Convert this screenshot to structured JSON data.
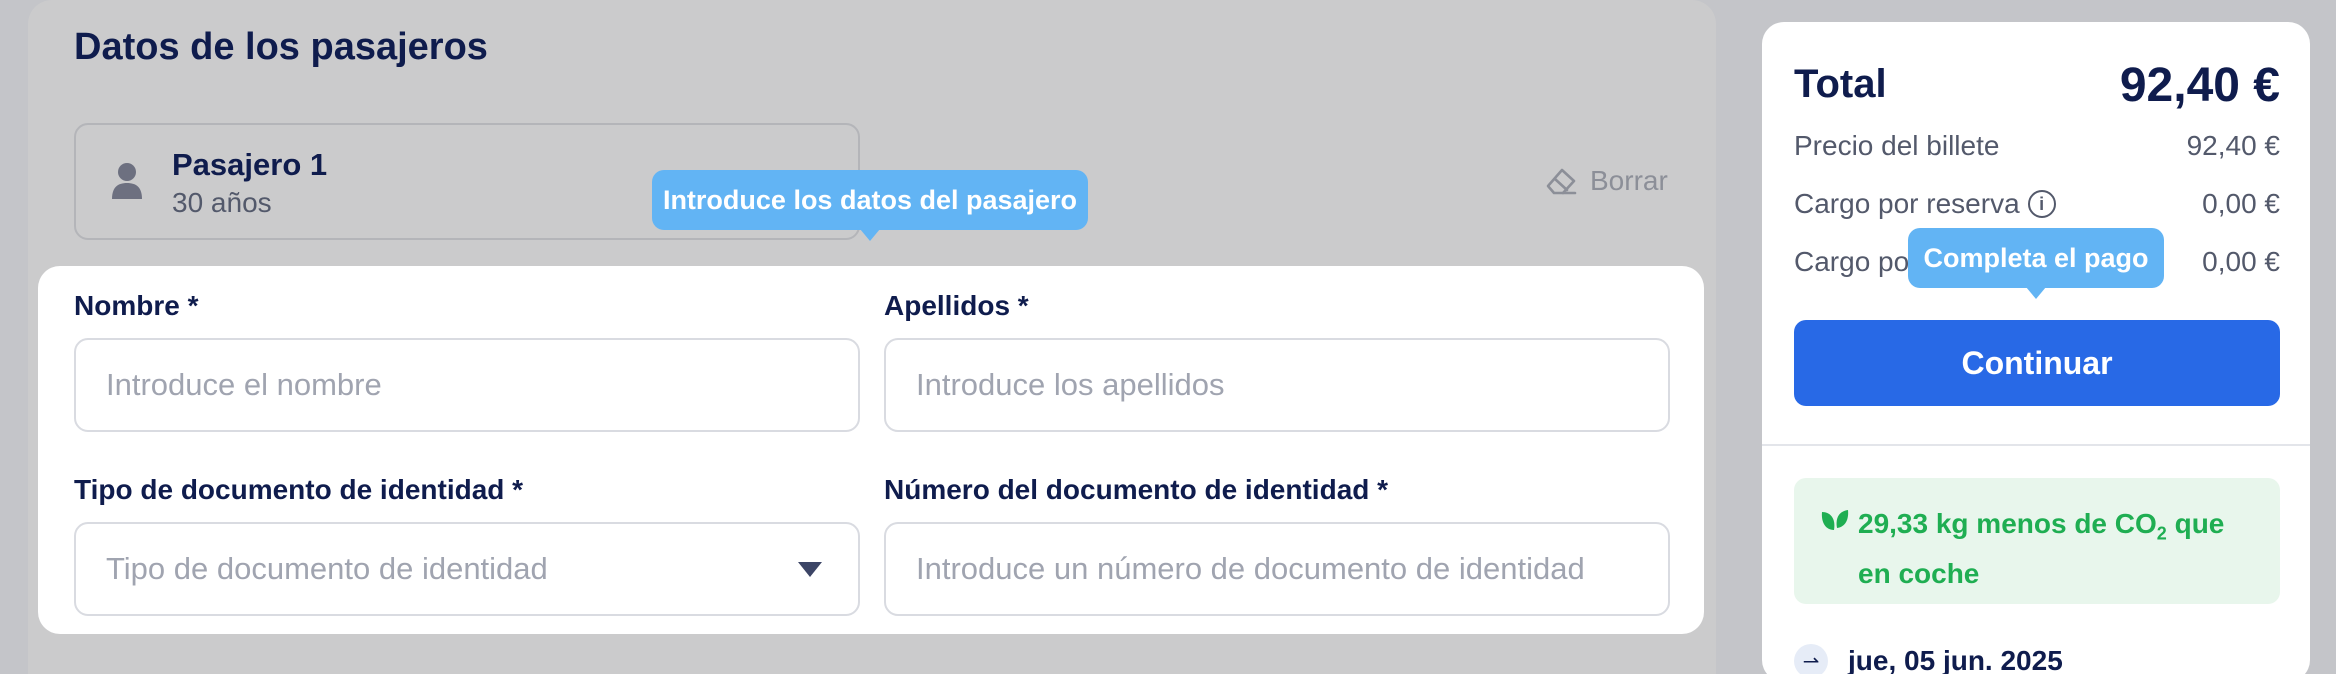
{
  "passengers_section": {
    "title": "Datos de los pasajeros",
    "passenger": {
      "name": "Pasajero 1",
      "age": "30 años"
    },
    "clear_label": "Borrar",
    "tooltip": "Introduce los datos del pasajero"
  },
  "form": {
    "first_name": {
      "label": "Nombre *",
      "placeholder": "Introduce el nombre"
    },
    "last_name": {
      "label": "Apellidos *",
      "placeholder": "Introduce los apellidos"
    },
    "doc_type": {
      "label": "Tipo de documento de identidad *",
      "placeholder": "Tipo de documento de identidad"
    },
    "doc_number": {
      "label": "Número del documento de identidad *",
      "placeholder": "Introduce un número de documento de identidad"
    }
  },
  "summary": {
    "total_label": "Total",
    "total_value": "92,40 €",
    "lines": [
      {
        "label": "Precio del billete",
        "value": "92,40 €"
      },
      {
        "label": "Cargo por reserva",
        "value": "0,00 €"
      },
      {
        "label": "Cargo po",
        "value": "0,00 €"
      }
    ],
    "pay_tooltip": "Completa el pago",
    "continue_label": "Continuar",
    "eco_text_pre": "29,33 kg menos de CO",
    "eco_sub": "2",
    "eco_text_post": " que en coche",
    "date": "jue, 05 jun. 2025"
  },
  "colors": {
    "primary": "#2869e6",
    "tooltip": "#62b4f4",
    "eco_text": "#1fae52",
    "eco_bg": "#e8f6ec",
    "heading": "#0f1c4d"
  },
  "icons": [
    "user-icon",
    "eraser-icon",
    "info-icon",
    "chevron-down-icon",
    "leaf-icon",
    "train-icon"
  ]
}
